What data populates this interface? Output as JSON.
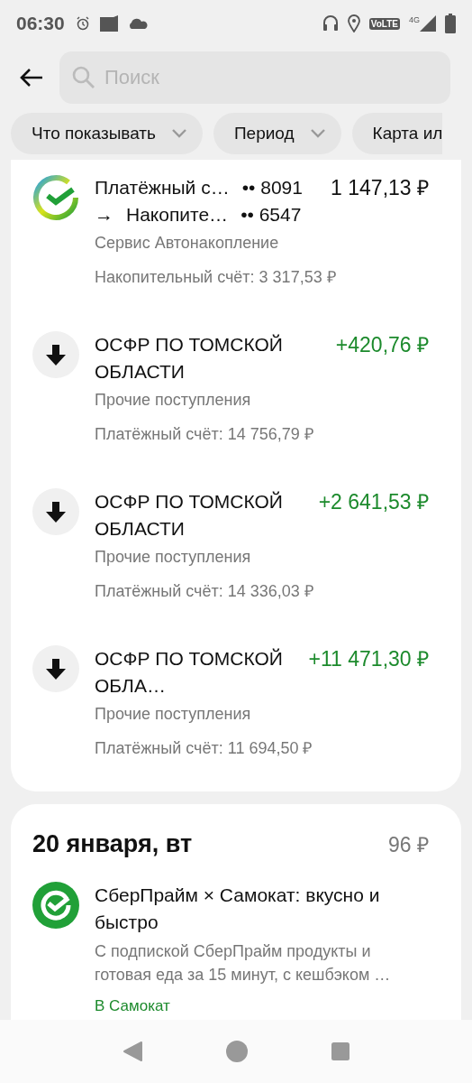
{
  "status_bar": {
    "time": "06:30",
    "volte": "VoLTE",
    "network": "4G"
  },
  "search": {
    "placeholder": "Поиск"
  },
  "filters": [
    {
      "label": "Что показывать",
      "caret": true
    },
    {
      "label": "Период",
      "caret": true
    },
    {
      "label": "Карта ил"
    }
  ],
  "day_groups": [
    {
      "transactions": [
        {
          "kind": "transfer",
          "from_name": "Платёжный с…",
          "from_mask": "•• 8091",
          "arrow": "→",
          "to_name": "Накопите…",
          "to_mask": "•• 6547",
          "amount": "1 147,13 ₽",
          "category": "Сервис Автонакопление",
          "balance": "Накопительный счёт: 3 317,53 ₽"
        },
        {
          "kind": "income",
          "title": "ОСФР ПО ТОМСКОЙ ОБЛАСТИ",
          "amount": "+420,76 ₽",
          "category": "Прочие поступления",
          "balance": "Платёжный счёт: 14 756,79 ₽"
        },
        {
          "kind": "income",
          "title": "ОСФР ПО ТОМСКОЙ ОБЛАСТИ",
          "amount": "+2 641,53 ₽",
          "category": "Прочие поступления",
          "balance": "Платёжный счёт: 14 336,03 ₽"
        },
        {
          "kind": "income",
          "title": "ОСФР ПО ТОМСКОЙ ОБЛА…",
          "amount": "+11 471,30 ₽",
          "category": "Прочие поступления",
          "balance": "Платёжный счёт: 11 694,50 ₽"
        }
      ]
    },
    {
      "date": "20 января, вт",
      "total": "96 ₽",
      "transactions": [
        {
          "kind": "promo",
          "title": "СберПрайм × Самокат: вкусно и быстро",
          "description": "С подпиской СберПрайм продукты и готовая еда за 15 минут, с кешбэком …",
          "link": "В Самокат"
        }
      ]
    }
  ]
}
